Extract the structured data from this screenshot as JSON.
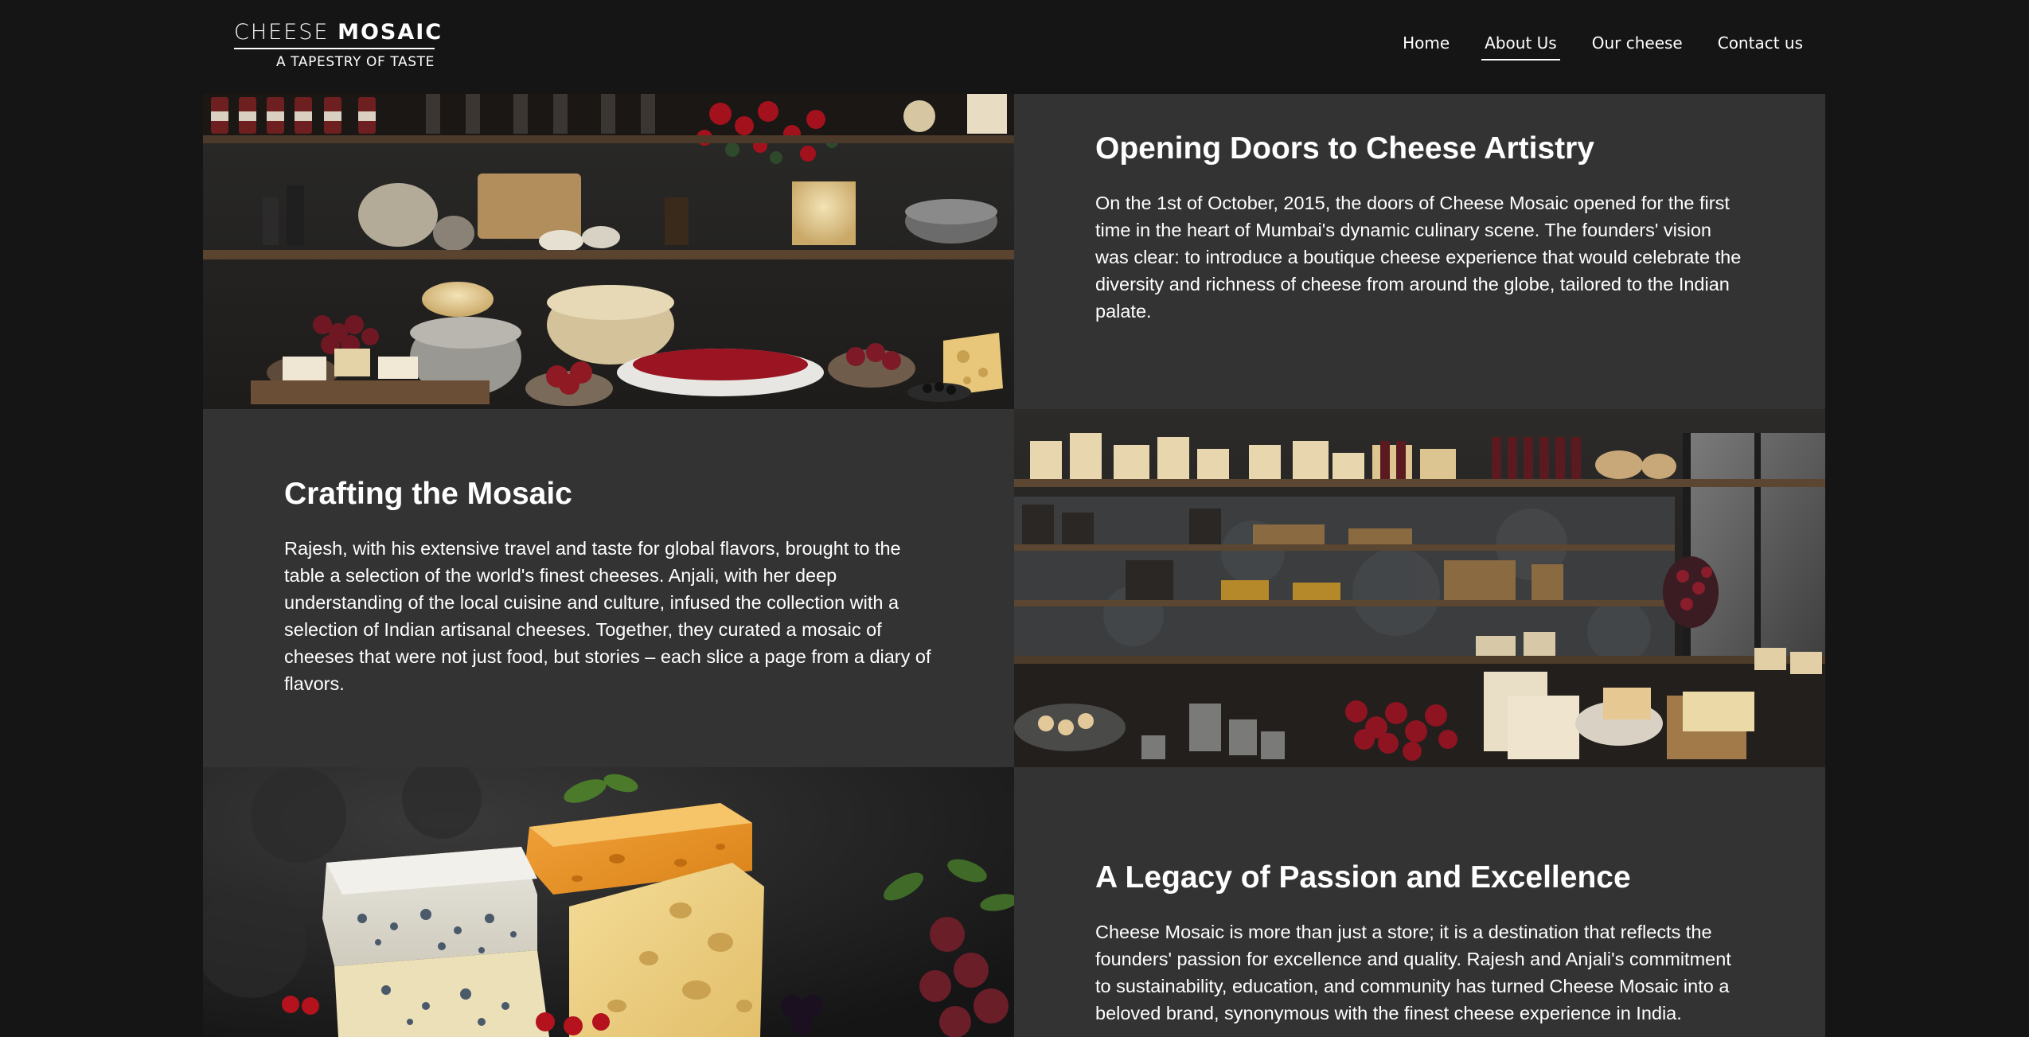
{
  "brand": {
    "name_light": "CHEESE",
    "name_bold": "MOSAIC",
    "tagline": "A TAPESTRY OF TASTE"
  },
  "nav": {
    "items": [
      {
        "label": "Home",
        "active": false
      },
      {
        "label": "About Us",
        "active": true
      },
      {
        "label": "Our cheese",
        "active": false
      },
      {
        "label": "Contact us",
        "active": false
      }
    ]
  },
  "sections": [
    {
      "title": "Opening Doors to Cheese Artistry",
      "body": "On the 1st of October, 2015, the doors of Cheese Mosaic opened for the first time in the heart of Mumbai's dynamic culinary scene. The founders' vision was clear: to introduce a boutique cheese experience that would celebrate the diversity and richness of cheese from around the globe, tailored to the Indian palate."
    },
    {
      "title": "Crafting the Mosaic",
      "body": "Rajesh, with his extensive travel and taste for global flavors, brought to the table a selection of the world's finest cheeses. Anjali, with her deep understanding of the local cuisine and culture, infused the collection with a selection of Indian artisanal cheeses. Together, they curated a mosaic of cheeses that were not just food, but stories – each slice a page from a diary of flavors."
    },
    {
      "title": "A Legacy of Passion and Excellence",
      "body": "Cheese Mosaic is more than just a store; it is a destination that reflects the founders' passion for excellence and quality. Rajesh and Anjali's commitment to sustainability, education, and community has turned Cheese Mosaic into a beloved brand, synonymous with the finest cheese experience in India."
    }
  ],
  "colors": {
    "page_bg": "#151515",
    "tile_bg": "#333333",
    "text": "#ffffff"
  }
}
